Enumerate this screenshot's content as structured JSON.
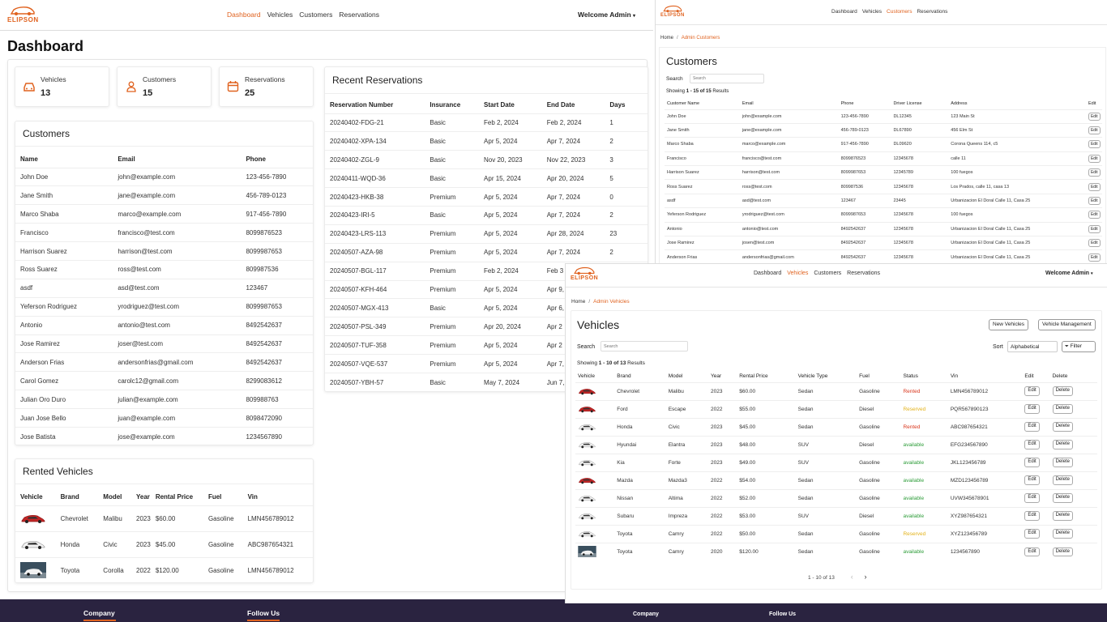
{
  "brand": {
    "name": "ELIPSON",
    "color": "#e0621f"
  },
  "colors": {
    "accent": "#e0621f",
    "rented": "#d9361c",
    "reserved": "#e3b219",
    "available": "#2e9d3a",
    "footer": "#2a2340"
  },
  "dashboard": {
    "nav": [
      "Dashboard",
      "Vehicles",
      "Customers",
      "Reservations"
    ],
    "active_nav": "Dashboard",
    "welcome": "Welcome Admin",
    "title": "Dashboard",
    "stats": [
      {
        "label": "Vehicles",
        "value": "13",
        "icon": "car-icon"
      },
      {
        "label": "Customers",
        "value": "15",
        "icon": "user-icon"
      },
      {
        "label": "Reservations",
        "value": "25",
        "icon": "calendar-icon"
      }
    ],
    "customers": {
      "title": "Customers",
      "headers": [
        "Name",
        "Email",
        "Phone"
      ],
      "rows": [
        [
          "John Doe",
          "john@example.com",
          "123-456-7890"
        ],
        [
          "Jane Smith",
          "jane@example.com",
          "456-789-0123"
        ],
        [
          "Marco Shaba",
          "marco@example.com",
          "917-456-7890"
        ],
        [
          "Francisco",
          "francisco@test.com",
          "8099876523"
        ],
        [
          "Harrison Suarez",
          "harrison@test.com",
          "8099987653"
        ],
        [
          "Ross Suarez",
          "ross@test.com",
          "809987536"
        ],
        [
          "asdf",
          "asd@test.com",
          "123467"
        ],
        [
          "Yeferson Rodriguez",
          "yrodriguez@test.com",
          "8099987653"
        ],
        [
          "Antonio",
          "antonio@test.com",
          "8492542637"
        ],
        [
          "Jose Ramirez",
          "joser@test.com",
          "8492542637"
        ],
        [
          "Anderson Frias",
          "andersonfrias@gmail.com",
          "8492542637"
        ],
        [
          "Carol Gomez",
          "carolc12@gmail.com",
          "8299083612"
        ],
        [
          "Julian Oro Duro",
          "julian@example.com",
          "809988763"
        ],
        [
          "Juan Jose Bello",
          "juan@example.com",
          "8098472090"
        ],
        [
          "Jose Batista",
          "jose@example.com",
          "1234567890"
        ]
      ]
    },
    "reservations": {
      "title": "Recent Reservations",
      "headers": [
        "Reservation Number",
        "Insurance",
        "Start Date",
        "End Date",
        "Days"
      ],
      "rows": [
        [
          "20240402-FDG-21",
          "Basic",
          "Feb 2, 2024",
          "Feb 2, 2024",
          "1"
        ],
        [
          "20240402-XPA-134",
          "Basic",
          "Apr 5, 2024",
          "Apr 7, 2024",
          "2"
        ],
        [
          "20240402-ZGL-9",
          "Basic",
          "Nov 20, 2023",
          "Nov 22, 2023",
          "3"
        ],
        [
          "20240411-WQD-36",
          "Basic",
          "Apr 15, 2024",
          "Apr 20, 2024",
          "5"
        ],
        [
          "20240423-HKB-38",
          "Premium",
          "Apr 5, 2024",
          "Apr 7, 2024",
          "0"
        ],
        [
          "20240423-IRI-5",
          "Basic",
          "Apr 5, 2024",
          "Apr 7, 2024",
          "2"
        ],
        [
          "20240423-LRS-113",
          "Premium",
          "Apr 5, 2024",
          "Apr 28, 2024",
          "23"
        ],
        [
          "20240507-AZA-98",
          "Premium",
          "Apr 5, 2024",
          "Apr 7, 2024",
          "2"
        ],
        [
          "20240507-BGL-117",
          "Premium",
          "Feb 2, 2024",
          "Feb 3",
          ""
        ],
        [
          "20240507-KFH-464",
          "Premium",
          "Apr 5, 2024",
          "Apr 9,",
          ""
        ],
        [
          "20240507-MGX-413",
          "Basic",
          "Apr 5, 2024",
          "Apr 6,",
          ""
        ],
        [
          "20240507-PSL-349",
          "Premium",
          "Apr 20, 2024",
          "Apr 2",
          ""
        ],
        [
          "20240507-TUF-358",
          "Premium",
          "Apr 5, 2024",
          "Apr 2",
          ""
        ],
        [
          "20240507-VQE-537",
          "Premium",
          "Apr 5, 2024",
          "Apr 7,",
          ""
        ],
        [
          "20240507-YBH-57",
          "Basic",
          "May 7, 2024",
          "Jun 7,",
          ""
        ]
      ]
    },
    "rented": {
      "title": "Rented Vehicles",
      "headers": [
        "Vehicle",
        "Brand",
        "Model",
        "Year",
        "Rental Price",
        "Fuel",
        "Vin"
      ],
      "rows": [
        [
          "red",
          "Chevrolet",
          "Malibu",
          "2023",
          "$60.00",
          "Gasoline",
          "LMN456789012"
        ],
        [
          "white",
          "Honda",
          "Civic",
          "2023",
          "$45.00",
          "Gasoline",
          "ABC987654321"
        ],
        [
          "photo",
          "Toyota",
          "Corolla",
          "2022",
          "$120.00",
          "Gasoline",
          "LMN456789012"
        ]
      ]
    },
    "footer": {
      "company": "Company",
      "follow": "Follow Us"
    }
  },
  "admin_customers": {
    "nav": [
      "Dashboard",
      "Vehicles",
      "Customers",
      "Reservations"
    ],
    "active_nav": "Customers",
    "breadcrumb": {
      "home": "Home",
      "separator": "/",
      "current": "Admin Customers"
    },
    "title": "Customers",
    "search_label": "Search",
    "search_placeholder": "Search",
    "showing": {
      "prefix": "Showing ",
      "range": "1 - 15 of 15",
      "suffix": " Results"
    },
    "headers": [
      "Customer Name",
      "Email",
      "Phone",
      "Driver License",
      "Address",
      "Edit"
    ],
    "edit_label": "Edit",
    "rows": [
      [
        "John Doe",
        "john@example.com",
        "123-456-7890",
        "DL12345",
        "123 Main St"
      ],
      [
        "Jane Smith",
        "jane@example.com",
        "456-789-0123",
        "DL67890",
        "456 Elm St"
      ],
      [
        "Marco Shaba",
        "marco@example.com",
        "917-456-7890",
        "DL09620",
        "Corona Queens 114, c5"
      ],
      [
        "Francisco",
        "francisco@test.com",
        "8099876523",
        "12345678",
        "calle 11"
      ],
      [
        "Harrison Suarez",
        "harrison@test.com",
        "8099987653",
        "12345789",
        "100 fuegos"
      ],
      [
        "Ross Suarez",
        "ross@test.com",
        "809987536",
        "12345678",
        "Los Prados, calle 11, casa 13"
      ],
      [
        "asdf",
        "asd@test.com",
        "123467",
        "23445",
        "Urbanizacion El Doral Calle 11, Casa 25"
      ],
      [
        "Yeferson Rodriguez",
        "yrodriguez@test.com",
        "8099987653",
        "12345678",
        "100 fuegos"
      ],
      [
        "Antonio",
        "antonio@test.com",
        "8492542637",
        "12345678",
        "Urbanizacion El Doral Calle 11, Casa 25"
      ],
      [
        "Jose Ramirez",
        "josen@test.com",
        "8492542637",
        "12345678",
        "Urbanizacion El Doral Calle 11, Casa 25"
      ],
      [
        "Anderson Frias",
        "andersonfrias@gmail.com",
        "8492542637",
        "12345678",
        "Urbanizacion El Doral Calle 11, Casa 25"
      ]
    ]
  },
  "admin_vehicles": {
    "nav": [
      "Dashboard",
      "Vehicles",
      "Customers",
      "Reservations"
    ],
    "active_nav": "Vehicles",
    "welcome": "Welcome Admin",
    "breadcrumb": {
      "home": "Home",
      "separator": "/",
      "current": "Admin Vehicles"
    },
    "title": "Vehicles",
    "new_button": "New Vehicles",
    "manage_button": "Vehicle Management",
    "search_label": "Search",
    "search_placeholder": "Search",
    "sort_label": "Sort",
    "sort_value": "Alphabetical",
    "filter_label": "Filter",
    "showing": {
      "prefix": "Showing ",
      "range": "1 - 10 of 13",
      "suffix": " Results"
    },
    "headers": [
      "Vehicle",
      "Brand",
      "Model",
      "Year",
      "Rental Price",
      "Vehicle Type",
      "Fuel",
      "Status",
      "Vin",
      "Edit",
      "Delete"
    ],
    "edit_label": "Edit",
    "delete_label": "Delete",
    "rows": [
      [
        "red",
        "Chevrolet",
        "Malibu",
        "2023",
        "$60.00",
        "Sedan",
        "Gasoline",
        "Rented",
        "LMN456789012"
      ],
      [
        "red",
        "Ford",
        "Escape",
        "2022",
        "$55.00",
        "Sedan",
        "Diesel",
        "Reserved",
        "PQR567890123"
      ],
      [
        "white",
        "Honda",
        "Civic",
        "2023",
        "$45.00",
        "Sedan",
        "Gasoline",
        "Rented",
        "ABC987654321"
      ],
      [
        "white",
        "Hyundai",
        "Elantra",
        "2023",
        "$48.00",
        "SUV",
        "Diesel",
        "available",
        "EFG234567890"
      ],
      [
        "white",
        "Kia",
        "Forte",
        "2023",
        "$49.00",
        "SUV",
        "Gasoline",
        "available",
        "JKL123456789"
      ],
      [
        "red",
        "Mazda",
        "Mazda3",
        "2022",
        "$54.00",
        "Sedan",
        "Gasoline",
        "available",
        "MZD123456789"
      ],
      [
        "white",
        "Nissan",
        "Altima",
        "2022",
        "$52.00",
        "Sedan",
        "Gasoline",
        "available",
        "UVW345678901"
      ],
      [
        "white",
        "Subaru",
        "Impreza",
        "2022",
        "$53.00",
        "SUV",
        "Diesel",
        "available",
        "XYZ987654321"
      ],
      [
        "white",
        "Toyota",
        "Camry",
        "2022",
        "$50.00",
        "Sedan",
        "Gasoline",
        "Reserved",
        "XYZ123456789"
      ],
      [
        "photo",
        "Toyota",
        "Camry",
        "2020",
        "$120.00",
        "Sedan",
        "Gasoline",
        "available",
        "1234567890"
      ]
    ],
    "pagination": {
      "range": "1 - 10 of 13",
      "prev": "‹",
      "next": "›"
    },
    "footer": {
      "company": "Company",
      "follow": "Follow Us"
    }
  }
}
